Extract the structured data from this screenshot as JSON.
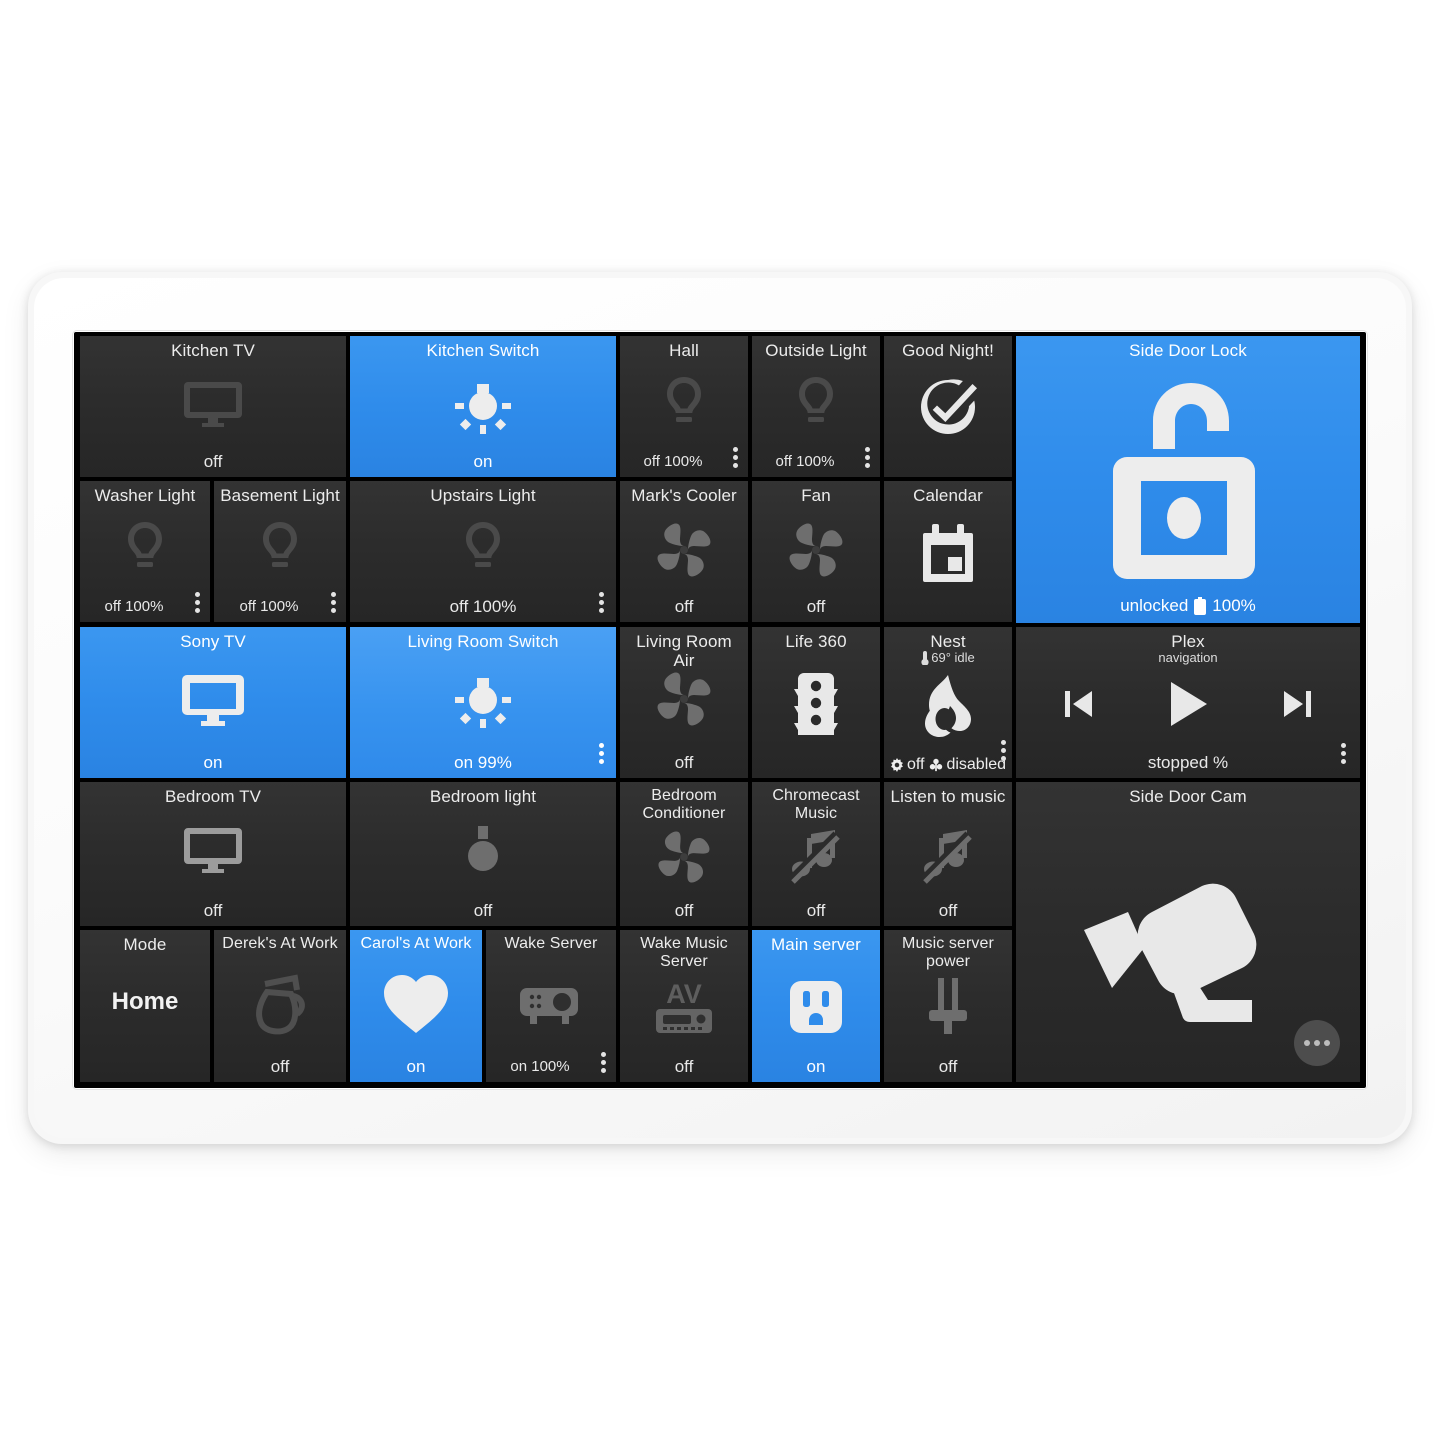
{
  "device": {
    "frame_color": "#f7f7f7",
    "screen_color": "#000000"
  },
  "theme": {
    "accent_blue": "#2f8ceb",
    "accent_blue_bright": "#3793ef",
    "tile_dark": "#2b2b2b",
    "text_light": "#e9e9e9"
  },
  "dashboard": {
    "tiles": [
      {
        "id": "kitchen-tv",
        "title": "Kitchen TV",
        "state": "off",
        "icon": "tv-icon",
        "active": false
      },
      {
        "id": "kitchen-switch",
        "title": "Kitchen Switch",
        "state": "on",
        "icon": "bulb-on-icon",
        "active": true
      },
      {
        "id": "hall",
        "title": "Hall",
        "state": "off 100%",
        "icon": "bulb-icon",
        "active": false,
        "menu": true
      },
      {
        "id": "outside-light",
        "title": "Outside Light",
        "state": "off 100%",
        "icon": "bulb-icon",
        "active": false,
        "menu": true
      },
      {
        "id": "good-night",
        "title": "Good Night!",
        "state": "",
        "icon": "check-circle-icon",
        "active": false
      },
      {
        "id": "side-door-lock",
        "title": "Side Door Lock",
        "state": "unlocked",
        "state_extra": "100%",
        "icon": "padlock-open-icon",
        "active": true,
        "battery": true
      },
      {
        "id": "washer-light",
        "title": "Washer Light",
        "state": "off 100%",
        "icon": "bulb-icon",
        "active": false,
        "menu": true
      },
      {
        "id": "basement-light",
        "title": "Basement Light",
        "state": "off 100%",
        "icon": "bulb-icon",
        "active": false,
        "menu": true
      },
      {
        "id": "upstairs-light",
        "title": "Upstairs Light",
        "state": "off 100%",
        "icon": "bulb-icon",
        "active": false,
        "menu": true
      },
      {
        "id": "marks-cooler",
        "title": "Mark's Cooler",
        "state": "off",
        "icon": "fan-icon",
        "active": false
      },
      {
        "id": "fan",
        "title": "Fan",
        "state": "off",
        "icon": "fan-icon",
        "active": false
      },
      {
        "id": "calendar",
        "title": "Calendar",
        "state": "",
        "icon": "calendar-icon",
        "active": false
      },
      {
        "id": "sony-tv",
        "title": "Sony TV",
        "state": "on",
        "icon": "tv-icon",
        "active": true
      },
      {
        "id": "living-room-switch",
        "title": "Living Room Switch",
        "state": "on 99%",
        "icon": "bulb-on-icon",
        "active": true,
        "menu": true
      },
      {
        "id": "living-room-air",
        "title": "Living Room Air",
        "state": "off",
        "icon": "fan-icon",
        "active": false
      },
      {
        "id": "life-360",
        "title": "Life 360",
        "state": "",
        "icon": "traffic-light-icon",
        "active": false
      },
      {
        "id": "nest",
        "title": "Nest",
        "subtitle": "69° idle",
        "icon": "flame-icon",
        "active": false,
        "footer": {
          "mode": "off",
          "fan": "disabled"
        },
        "menu": true
      },
      {
        "id": "plex",
        "title": "Plex",
        "subtitle": "navigation",
        "state": "stopped %",
        "icon": "media-transport",
        "active": false,
        "menu": true
      },
      {
        "id": "bedroom-tv",
        "title": "Bedroom TV",
        "state": "off",
        "icon": "tv-icon",
        "active": false
      },
      {
        "id": "bedroom-light",
        "title": "Bedroom light",
        "state": "off",
        "icon": "bulb-plain-icon",
        "active": false
      },
      {
        "id": "bedroom-conditioner",
        "title": "Bedroom\nConditioner",
        "state": "off",
        "icon": "fan-icon",
        "active": false
      },
      {
        "id": "chromecast-music",
        "title": "Chromecast\nMusic",
        "state": "off",
        "icon": "music-off-icon",
        "active": false
      },
      {
        "id": "listen-to-music",
        "title": "Listen to music",
        "state": "off",
        "icon": "music-off-icon",
        "active": false
      },
      {
        "id": "side-door-cam",
        "title": "Side Door Cam",
        "state": "",
        "icon": "cctv-camera-icon",
        "active": false,
        "fab": true
      },
      {
        "id": "mode",
        "title": "Mode",
        "value": "Home",
        "icon": "",
        "active": false
      },
      {
        "id": "dereks-at-work",
        "title": "Derek's At Work",
        "state": "off",
        "icon": "coffee-pot-icon",
        "active": false
      },
      {
        "id": "carols-at-work",
        "title": "Carol's At Work",
        "state": "on",
        "icon": "heart-icon",
        "active": true
      },
      {
        "id": "wake-server",
        "title": "Wake Server",
        "state": "on 100%",
        "icon": "projector-icon",
        "active": false,
        "menu": true
      },
      {
        "id": "wake-music-server",
        "title": "Wake Music\nServer",
        "state": "off",
        "icon": "av-receiver-icon",
        "active": false
      },
      {
        "id": "main-server",
        "title": "Main server",
        "state": "on",
        "icon": "power-outlet-icon",
        "active": true
      },
      {
        "id": "music-server-power",
        "title": "Music server\npower",
        "state": "off",
        "icon": "plug-icon",
        "active": false
      }
    ]
  }
}
